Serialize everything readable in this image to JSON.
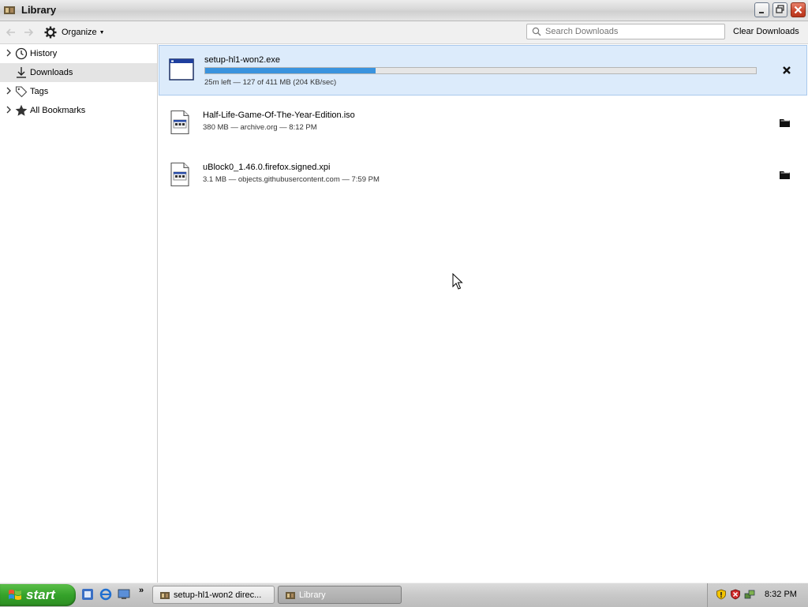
{
  "window": {
    "title": "Library",
    "icon": "library-app-icon"
  },
  "toolbar": {
    "organize_label": "Organize",
    "search_placeholder": "Search Downloads",
    "clear_label": "Clear Downloads"
  },
  "sidebar": {
    "items": [
      {
        "label": "History",
        "icon": "clock-icon",
        "expandable": true
      },
      {
        "label": "Downloads",
        "icon": "download-icon",
        "expandable": false,
        "selected": true
      },
      {
        "label": "Tags",
        "icon": "tag-icon",
        "expandable": true
      },
      {
        "label": "All Bookmarks",
        "icon": "star-icon",
        "expandable": true
      }
    ]
  },
  "downloads": [
    {
      "name": "setup-hl1-won2.exe",
      "status": "25m left — 127 of 411 MB (204 KB/sec)",
      "progress": 0.31,
      "state": "in-progress",
      "action": "cancel"
    },
    {
      "name": "Half-Life-Game-Of-The-Year-Edition.iso",
      "status": "380 MB — archive.org — 8:12 PM",
      "state": "complete",
      "action": "open-folder"
    },
    {
      "name": "uBlock0_1.46.0.firefox.signed.xpi",
      "status": "3.1 MB — objects.githubusercontent.com — 7:59 PM",
      "state": "complete",
      "action": "open-folder"
    }
  ],
  "taskbar": {
    "start_label": "start",
    "tasks": [
      {
        "label": "setup-hl1-won2 direc..."
      },
      {
        "label": "Library",
        "active": true
      }
    ],
    "clock": "8:32 PM"
  },
  "colors": {
    "progress_fill": "#3a93de",
    "active_row_bg": "#dcebfb",
    "start_green": "#35a22a"
  }
}
